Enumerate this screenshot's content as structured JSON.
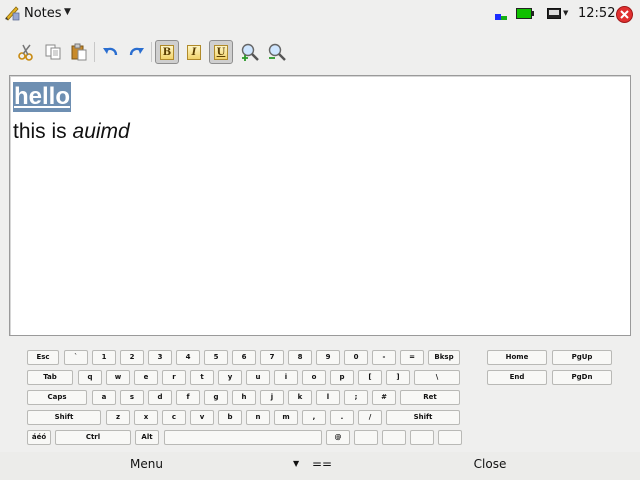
{
  "statusbar": {
    "app_title": "Notes",
    "clock": "12:52",
    "icons": [
      "notes-app-icon",
      "network-icon",
      "battery-icon",
      "display-icon",
      "close-app-icon"
    ],
    "battery_color": "#10c000",
    "close_color": "#e03030"
  },
  "toolbar": {
    "buttons": [
      "cut-icon",
      "copy-icon",
      "paste-icon",
      "undo-icon",
      "redo-icon",
      "bold-button",
      "italic-button",
      "underline-button",
      "zoom-in-icon",
      "zoom-out-icon"
    ],
    "bold_label": "B",
    "italic_label": "I",
    "underline_label": "U",
    "bold_active": true,
    "underline_active": true
  },
  "editor": {
    "line1": "hello",
    "line2_prefix": "this is ",
    "line2_italic": "auimd",
    "selection_color": "#6e8fb2"
  },
  "keyboard": {
    "rows": [
      [
        "Esc",
        "`",
        "1",
        "2",
        "3",
        "4",
        "5",
        "6",
        "7",
        "8",
        "9",
        "0",
        "-",
        "=",
        "Bksp"
      ],
      [
        "Tab",
        "q",
        "w",
        "e",
        "r",
        "t",
        "y",
        "u",
        "i",
        "o",
        "p",
        "[",
        "]",
        "\\"
      ],
      [
        "Caps",
        "a",
        "s",
        "d",
        "f",
        "g",
        "h",
        "j",
        "k",
        "l",
        ";",
        "#",
        "Ret"
      ],
      [
        "Shift",
        "z",
        "x",
        "c",
        "v",
        "b",
        "n",
        "m",
        ",",
        ".",
        "/",
        "Shift"
      ],
      [
        "áéó",
        "Ctrl",
        "Alt",
        "",
        "@",
        "",
        "",
        "",
        ""
      ]
    ],
    "nav": [
      [
        "Home",
        "PgUp"
      ],
      [
        "End",
        "PgDn"
      ]
    ]
  },
  "bottombar": {
    "menu_label": "Menu",
    "mode_label": "==",
    "close_label": "Close"
  }
}
